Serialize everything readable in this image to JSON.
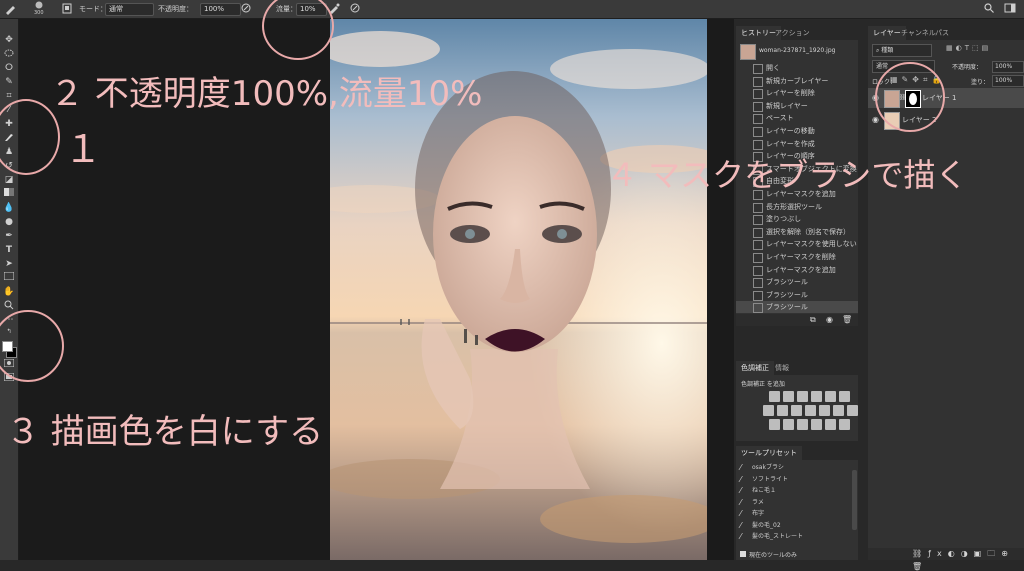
{
  "options_bar": {
    "brush_size": "300",
    "mode_label": "モード：",
    "mode_value": "通常",
    "opacity_label": "不透明度：",
    "opacity_value": "100%",
    "flow_label": "流量：",
    "flow_value": "10%"
  },
  "toolbar": {
    "tools": [
      "move-icon",
      "marquee-icon",
      "lasso-icon",
      "quick-select-icon",
      "crop-icon",
      "eyedropper-icon",
      "healing-icon",
      "brush-icon",
      "stamp-icon",
      "history-brush-icon",
      "eraser-icon",
      "gradient-icon",
      "blur-icon",
      "dodge-icon",
      "pen-icon",
      "type-icon",
      "path-select-icon",
      "shape-icon",
      "hand-icon",
      "zoom-icon",
      "more-icon"
    ],
    "foreground_color": "#ffffff",
    "background_color": "#000000"
  },
  "history_panel": {
    "tabs": [
      "ヒストリー",
      "アクション"
    ],
    "snapshot": "woman-237871_1920.jpg",
    "items": [
      "開く",
      "新規カーブレイヤー",
      "レイヤーを削除",
      "新規レイヤー",
      "ペースト",
      "レイヤーの移動",
      "レイヤーを作成",
      "レイヤーの順序",
      "スマートオブジェクトに変換",
      "自由変形",
      "レイヤーマスクを追加",
      "長方形選択ツール",
      "塗りつぶし",
      "選択を解除（別名で保存）",
      "レイヤーマスクを使用しない",
      "レイヤーマスクを削除",
      "レイヤーマスクを追加",
      "ブラシツール",
      "ブラシツール",
      "ブラシツール"
    ],
    "selected_index": 19
  },
  "adjustments_panel": {
    "tabs": [
      "色調補正",
      "情報"
    ],
    "add_label": "色調補正 を追加"
  },
  "tool_presets_panel": {
    "tab": "ツールプリセット",
    "items": [
      "osakブラシ",
      "ソフトライト",
      "ねこ毛１",
      "ラメ",
      "布字",
      "髪の毛_02",
      "髪の毛_ストレート"
    ],
    "current_tool_only": "現在のツールのみ"
  },
  "layers_panel": {
    "tabs": [
      "レイヤー",
      "チャンネル",
      "パス"
    ],
    "kind_filter": "種類",
    "blend_mode": "通常",
    "opacity_label": "不透明度：",
    "opacity_value": "100%",
    "lock_label": "ロック：",
    "fill_label": "塗り：",
    "fill_value": "100%",
    "layers": [
      {
        "name": "レイヤー 1",
        "has_mask": true
      },
      {
        "name": "レイヤー 2",
        "has_mask": false
      }
    ]
  },
  "annotations": {
    "step1": "１",
    "step2": "２ 不透明度100%,流量10%",
    "step3": "３ 描画色を白にする",
    "step4": "４ マスクをブラシで描く"
  },
  "colors": {
    "annotation": "#f2bcbc",
    "circle": "#e8a9a9",
    "panel_bg": "#323232"
  }
}
